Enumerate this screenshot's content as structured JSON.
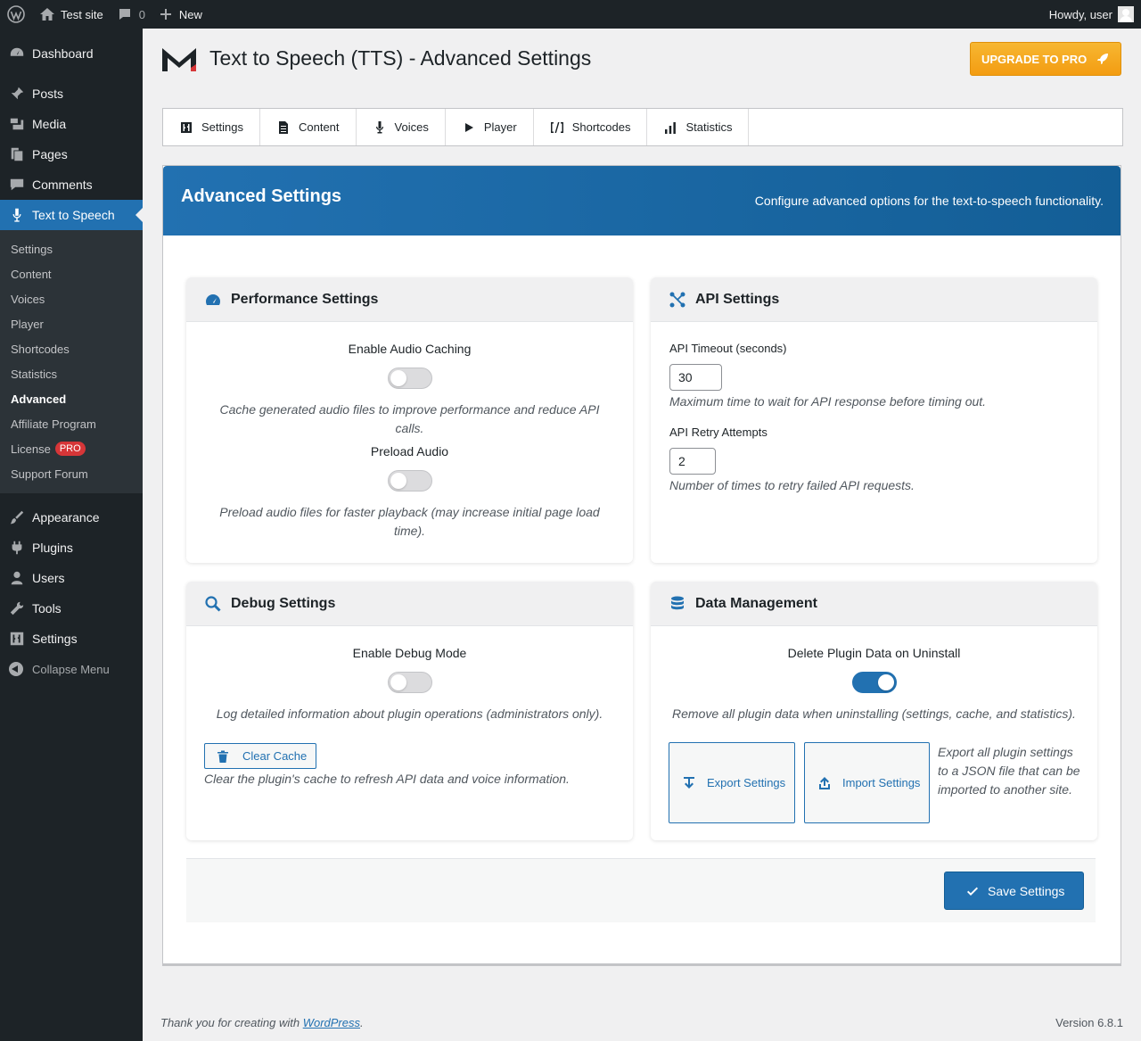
{
  "adminbar": {
    "site_name": "Test site",
    "comments_count": "0",
    "new_label": "New",
    "howdy": "Howdy, user"
  },
  "sidebar": {
    "dashboard": "Dashboard",
    "posts": "Posts",
    "media": "Media",
    "pages": "Pages",
    "comments": "Comments",
    "tts": "Text to Speech",
    "submenu": [
      "Settings",
      "Content",
      "Voices",
      "Player",
      "Shortcodes",
      "Statistics",
      "Advanced",
      "Affiliate Program",
      "License",
      "Support Forum"
    ],
    "license_badge": "PRO",
    "appearance": "Appearance",
    "plugins": "Plugins",
    "users": "Users",
    "tools": "Tools",
    "settings": "Settings",
    "collapse": "Collapse Menu"
  },
  "header": {
    "title": "Text to Speech (TTS) - Advanced Settings",
    "upgrade": "UPGRADE TO PRO"
  },
  "tabs": [
    "Settings",
    "Content",
    "Voices",
    "Player",
    "Shortcodes",
    "Statistics"
  ],
  "hero": {
    "title": "Advanced Settings",
    "subtitle": "Configure advanced options for the text-to-speech functionality."
  },
  "performance": {
    "title": "Performance Settings",
    "caching_label": "Enable Audio Caching",
    "caching_desc": "Cache generated audio files to improve performance and reduce API calls.",
    "preload_label": "Preload Audio",
    "preload_desc": "Preload audio files for faster playback (may increase initial page load time).",
    "caching_on": false,
    "preload_on": false
  },
  "api": {
    "title": "API Settings",
    "timeout_label": "API Timeout (seconds)",
    "timeout_value": "30",
    "timeout_desc": "Maximum time to wait for API response before timing out.",
    "retry_label": "API Retry Attempts",
    "retry_value": "2",
    "retry_desc": "Number of times to retry failed API requests."
  },
  "debug": {
    "title": "Debug Settings",
    "mode_label": "Enable Debug Mode",
    "mode_desc": "Log detailed information about plugin operations (administrators only).",
    "clear_cache": "Clear Cache",
    "clear_desc": "Clear the plugin's cache to refresh API data and voice information.",
    "mode_on": false
  },
  "data": {
    "title": "Data Management",
    "delete_label": "Delete Plugin Data on Uninstall",
    "delete_desc": "Remove all plugin data when uninstalling (settings, cache, and statistics).",
    "export": "Export Settings",
    "import": "Import Settings",
    "export_desc": "Export all plugin settings to a JSON file that can be imported to another site.",
    "delete_on": true
  },
  "save": "Save Settings",
  "footer": {
    "thanks_prefix": "Thank you for creating with ",
    "wp_link": "WordPress",
    "thanks_suffix": ".",
    "version": "Version 6.8.1"
  },
  "colors": {
    "accent": "#2271b1",
    "upgrade": "#f39c12",
    "sidebar": "#1d2327"
  }
}
